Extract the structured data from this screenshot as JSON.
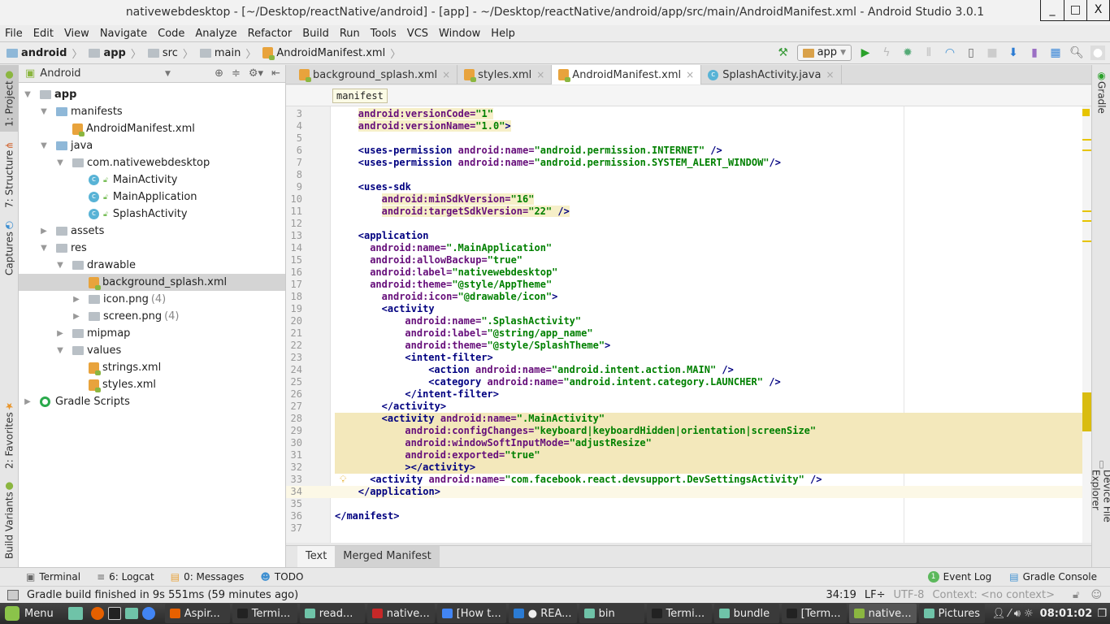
{
  "window": {
    "title": "nativewebdesktop - [~/Desktop/reactNative/android] - [app] - ~/Desktop/reactNative/android/app/src/main/AndroidManifest.xml - Android Studio 3.0.1",
    "min": "_",
    "max": "□",
    "close": "X"
  },
  "menu": [
    "File",
    "Edit",
    "View",
    "Navigate",
    "Code",
    "Analyze",
    "Refactor",
    "Build",
    "Run",
    "Tools",
    "VCS",
    "Window",
    "Help"
  ],
  "breadcrumb": [
    "android",
    "app",
    "src",
    "main",
    "AndroidManifest.xml"
  ],
  "toolbar": {
    "config": "app",
    "icons": [
      "make-project-icon",
      "run-icon",
      "apply-changes-icon",
      "debug-icon",
      "attach-debugger-icon",
      "profile-icon",
      "android-device-icon",
      "stop-icon",
      "sdk-manager-icon",
      "avd-manager-icon",
      "project-structure-icon",
      "search-icon",
      "user-icon"
    ]
  },
  "left_tabs": [
    "1: Project",
    "7: Structure",
    "Captures",
    "2: Favorites",
    "Build Variants"
  ],
  "right_tabs": [
    "Gradle",
    "Device File Explorer"
  ],
  "project": {
    "view": "Android",
    "tree": [
      {
        "label": "app",
        "depth": 0,
        "arrow": "down",
        "icon": "module",
        "bold": true
      },
      {
        "label": "manifests",
        "depth": 1,
        "arrow": "down",
        "icon": "folder-blue"
      },
      {
        "label": "AndroidManifest.xml",
        "depth": 2,
        "arrow": "",
        "icon": "xml"
      },
      {
        "label": "java",
        "depth": 1,
        "arrow": "down",
        "icon": "folder-blue"
      },
      {
        "label": "com.nativewebdesktop",
        "depth": 2,
        "arrow": "down",
        "icon": "package"
      },
      {
        "label": "MainActivity",
        "depth": 3,
        "arrow": "",
        "icon": "class"
      },
      {
        "label": "MainApplication",
        "depth": 3,
        "arrow": "",
        "icon": "class"
      },
      {
        "label": "SplashActivity",
        "depth": 3,
        "arrow": "",
        "icon": "class"
      },
      {
        "label": "assets",
        "depth": 1,
        "arrow": "right",
        "icon": "folder"
      },
      {
        "label": "res",
        "depth": 1,
        "arrow": "down",
        "icon": "folder"
      },
      {
        "label": "drawable",
        "depth": 2,
        "arrow": "down",
        "icon": "package"
      },
      {
        "label": "background_splash.xml",
        "depth": 3,
        "arrow": "",
        "icon": "xml",
        "selected": true
      },
      {
        "label": "icon.png",
        "depth": 3,
        "arrow": "right",
        "icon": "package",
        "count": "(4)"
      },
      {
        "label": "screen.png",
        "depth": 3,
        "arrow": "right",
        "icon": "package",
        "count": "(4)"
      },
      {
        "label": "mipmap",
        "depth": 2,
        "arrow": "right",
        "icon": "package"
      },
      {
        "label": "values",
        "depth": 2,
        "arrow": "down",
        "icon": "package"
      },
      {
        "label": "strings.xml",
        "depth": 3,
        "arrow": "",
        "icon": "xml"
      },
      {
        "label": "styles.xml",
        "depth": 3,
        "arrow": "",
        "icon": "xml"
      },
      {
        "label": "Gradle Scripts",
        "depth": 0,
        "arrow": "right",
        "icon": "gradle"
      }
    ]
  },
  "tabs": [
    {
      "label": "background_splash.xml",
      "icon": "xml"
    },
    {
      "label": "styles.xml",
      "icon": "xml"
    },
    {
      "label": "AndroidManifest.xml",
      "icon": "manifest",
      "active": true
    },
    {
      "label": "SplashActivity.java",
      "icon": "class"
    }
  ],
  "editor_breadcrumb": "manifest",
  "code": [
    {
      "n": "3",
      "i": 4,
      "parts": [
        [
          "a",
          "android:versionCode="
        ],
        [
          "v",
          "\"1\""
        ]
      ],
      "attrbg": true
    },
    {
      "n": "4",
      "i": 4,
      "parts": [
        [
          "a",
          "android:versionName="
        ],
        [
          "v",
          "\"1.0\""
        ],
        [
          "t",
          ">"
        ]
      ],
      "attrbg": true
    },
    {
      "n": "5",
      "i": 0,
      "parts": []
    },
    {
      "n": "6",
      "i": 4,
      "parts": [
        [
          "t",
          "<uses-permission "
        ],
        [
          "a",
          "android:name="
        ],
        [
          "v",
          "\"android.permission.INTERNET\""
        ],
        [
          "t",
          " />"
        ]
      ]
    },
    {
      "n": "7",
      "i": 4,
      "parts": [
        [
          "t",
          "<uses-permission "
        ],
        [
          "a",
          "android:name="
        ],
        [
          "v",
          "\"android.permission.SYSTEM_ALERT_WINDOW\""
        ],
        [
          "t",
          "/>"
        ]
      ]
    },
    {
      "n": "8",
      "i": 0,
      "parts": []
    },
    {
      "n": "9",
      "i": 4,
      "parts": [
        [
          "t",
          "<uses-sdk"
        ]
      ]
    },
    {
      "n": "10",
      "i": 8,
      "parts": [
        [
          "a",
          "android:minSdkVersion="
        ],
        [
          "v",
          "\"16\""
        ]
      ],
      "attrbg": true
    },
    {
      "n": "11",
      "i": 8,
      "parts": [
        [
          "a",
          "android:targetSdkVersion="
        ],
        [
          "v",
          "\"22\""
        ],
        [
          "t",
          " />"
        ]
      ],
      "attrbg": true
    },
    {
      "n": "12",
      "i": 0,
      "parts": []
    },
    {
      "n": "13",
      "i": 4,
      "parts": [
        [
          "t",
          "<application"
        ]
      ]
    },
    {
      "n": "14",
      "i": 6,
      "parts": [
        [
          "a",
          "android:name="
        ],
        [
          "v",
          "\".MainApplication\""
        ]
      ]
    },
    {
      "n": "15",
      "i": 6,
      "parts": [
        [
          "a",
          "android:allowBackup="
        ],
        [
          "v",
          "\"true\""
        ]
      ]
    },
    {
      "n": "16",
      "i": 6,
      "parts": [
        [
          "a",
          "android:label="
        ],
        [
          "v",
          "\"nativewebdesktop\""
        ]
      ]
    },
    {
      "n": "17",
      "i": 6,
      "parts": [
        [
          "a",
          "android:theme="
        ],
        [
          "v",
          "\"@style/AppTheme\""
        ]
      ]
    },
    {
      "n": "18",
      "i": 8,
      "parts": [
        [
          "a",
          "android:icon="
        ],
        [
          "v",
          "\"@drawable/icon\""
        ],
        [
          "t",
          ">"
        ]
      ]
    },
    {
      "n": "19",
      "i": 8,
      "parts": [
        [
          "t",
          "<activity"
        ]
      ]
    },
    {
      "n": "20",
      "i": 12,
      "parts": [
        [
          "a",
          "android:name="
        ],
        [
          "v",
          "\".SplashActivity\""
        ]
      ]
    },
    {
      "n": "21",
      "i": 12,
      "parts": [
        [
          "a",
          "android:label="
        ],
        [
          "v",
          "\"@string/app_name\""
        ]
      ]
    },
    {
      "n": "22",
      "i": 12,
      "parts": [
        [
          "a",
          "android:theme="
        ],
        [
          "v",
          "\"@style/SplashTheme\""
        ],
        [
          "t",
          ">"
        ]
      ]
    },
    {
      "n": "23",
      "i": 12,
      "parts": [
        [
          "t",
          "<intent-filter>"
        ]
      ]
    },
    {
      "n": "24",
      "i": 16,
      "parts": [
        [
          "t",
          "<action "
        ],
        [
          "a",
          "android:name="
        ],
        [
          "v",
          "\"android.intent.action.MAIN\""
        ],
        [
          "t",
          " />"
        ]
      ]
    },
    {
      "n": "25",
      "i": 16,
      "parts": [
        [
          "t",
          "<category "
        ],
        [
          "a",
          "android:name="
        ],
        [
          "v",
          "\"android.intent.category.LAUNCHER\""
        ],
        [
          "t",
          " />"
        ]
      ]
    },
    {
      "n": "26",
      "i": 12,
      "parts": [
        [
          "t",
          "</intent-filter>"
        ]
      ]
    },
    {
      "n": "27",
      "i": 8,
      "parts": [
        [
          "t",
          "</activity>"
        ]
      ]
    },
    {
      "n": "28",
      "i": 8,
      "parts": [
        [
          "t",
          "<activity "
        ],
        [
          "a",
          "android:name="
        ],
        [
          "v",
          "\".MainActivity\""
        ]
      ],
      "hl": true
    },
    {
      "n": "29",
      "i": 12,
      "parts": [
        [
          "a",
          "android:configChanges="
        ],
        [
          "v",
          "\"keyboard|keyboardHidden|orientation|screenSize\""
        ]
      ],
      "hl": true
    },
    {
      "n": "30",
      "i": 12,
      "parts": [
        [
          "a",
          "android:windowSoftInputMode="
        ],
        [
          "v",
          "\"adjustResize\""
        ]
      ],
      "hl": true
    },
    {
      "n": "31",
      "i": 12,
      "parts": [
        [
          "a",
          "android:exported="
        ],
        [
          "v",
          "\"true\""
        ]
      ],
      "hl": true
    },
    {
      "n": "32",
      "i": 12,
      "parts": [
        [
          "t",
          "></activity>"
        ]
      ],
      "hl": true
    },
    {
      "n": "33",
      "i": 6,
      "parts": [
        [
          "t",
          "<activity "
        ],
        [
          "a",
          "android:name="
        ],
        [
          "v",
          "\"com.facebook.react.devsupport.DevSettingsActivity\""
        ],
        [
          "t",
          " />"
        ]
      ]
    },
    {
      "n": "34",
      "i": 4,
      "parts": [
        [
          "t",
          "</application>"
        ]
      ],
      "cur": true
    },
    {
      "n": "35",
      "i": 0,
      "parts": []
    },
    {
      "n": "36",
      "i": 0,
      "parts": [
        [
          "t",
          "</manifest>"
        ]
      ]
    },
    {
      "n": "37",
      "i": 0,
      "parts": []
    }
  ],
  "editor_tabs": [
    "Text",
    "Merged Manifest"
  ],
  "bottom_tools": [
    {
      "label": "Terminal",
      "icon": "terminal-icon"
    },
    {
      "label": "6: Logcat",
      "icon": "logcat-icon"
    },
    {
      "label": "0: Messages",
      "icon": "messages-icon"
    },
    {
      "label": "TODO",
      "icon": "todo-icon"
    }
  ],
  "bottom_right_tools": [
    {
      "label": "Event Log",
      "badge": "1"
    },
    {
      "label": "Gradle Console"
    }
  ],
  "status": {
    "message": "Gradle build finished in 9s 551ms (59 minutes ago)",
    "position": "34:19",
    "line_sep": "LF÷",
    "encoding": "UTF-8",
    "context": "Context: <no context>"
  },
  "taskbar": {
    "menu": "Menu",
    "items": [
      {
        "label": "Aspir...",
        "color": "#e66000"
      },
      {
        "label": "Termi...",
        "color": "#222"
      },
      {
        "label": "read...",
        "color": "#6fc3a8"
      },
      {
        "label": "native...",
        "color": "#c62828"
      },
      {
        "label": "[How t...",
        "color": "#4285f4"
      },
      {
        "label": "● REA...",
        "color": "#2b7bd3"
      },
      {
        "label": "bin",
        "color": "#6fc3a8"
      },
      {
        "label": "Termi...",
        "color": "#222"
      },
      {
        "label": "bundle",
        "color": "#6fc3a8"
      },
      {
        "label": "[Term...",
        "color": "#222"
      },
      {
        "label": "native...",
        "color": "#8bb640",
        "active": true
      },
      {
        "label": "Pictures",
        "color": "#6fc3a8"
      }
    ],
    "clock": "08:01:02"
  }
}
